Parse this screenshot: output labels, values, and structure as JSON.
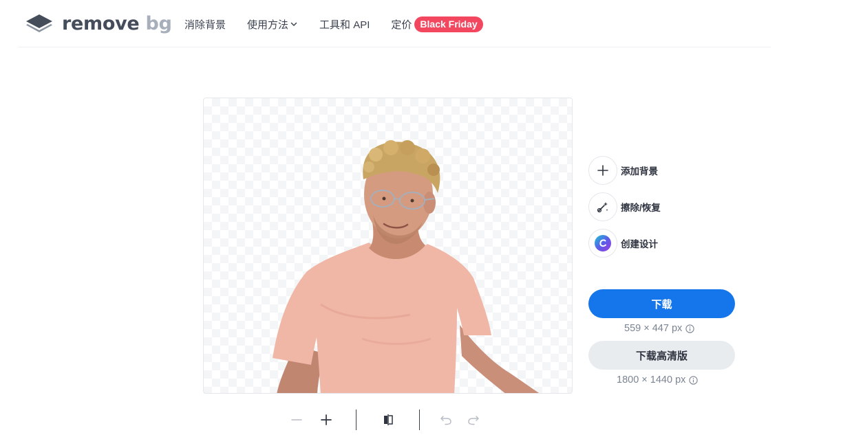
{
  "brand": {
    "name_main": "remove",
    "name_accent": "bg"
  },
  "nav": {
    "items": [
      {
        "label": "消除背景"
      },
      {
        "label": "使用方法"
      },
      {
        "label": "工具和 API"
      }
    ],
    "pricing_label": "定价",
    "promo_badge": "Black Friday"
  },
  "actions": {
    "add_background": "添加背景",
    "erase_restore": "擦除/恢复",
    "create_design": "创建设计"
  },
  "download": {
    "label": "下载",
    "size": "559 × 447 px",
    "hd_label": "下载高清版",
    "hd_size": "1800 × 1440 px"
  },
  "colors": {
    "primary": "#1476ea",
    "promo": "#f2475f",
    "secondary_button": "#e9ecef"
  },
  "icons": {
    "zoom_out": "minus-icon",
    "zoom_in": "plus-icon",
    "compare": "compare-icon",
    "undo": "undo-icon",
    "redo": "redo-icon"
  }
}
